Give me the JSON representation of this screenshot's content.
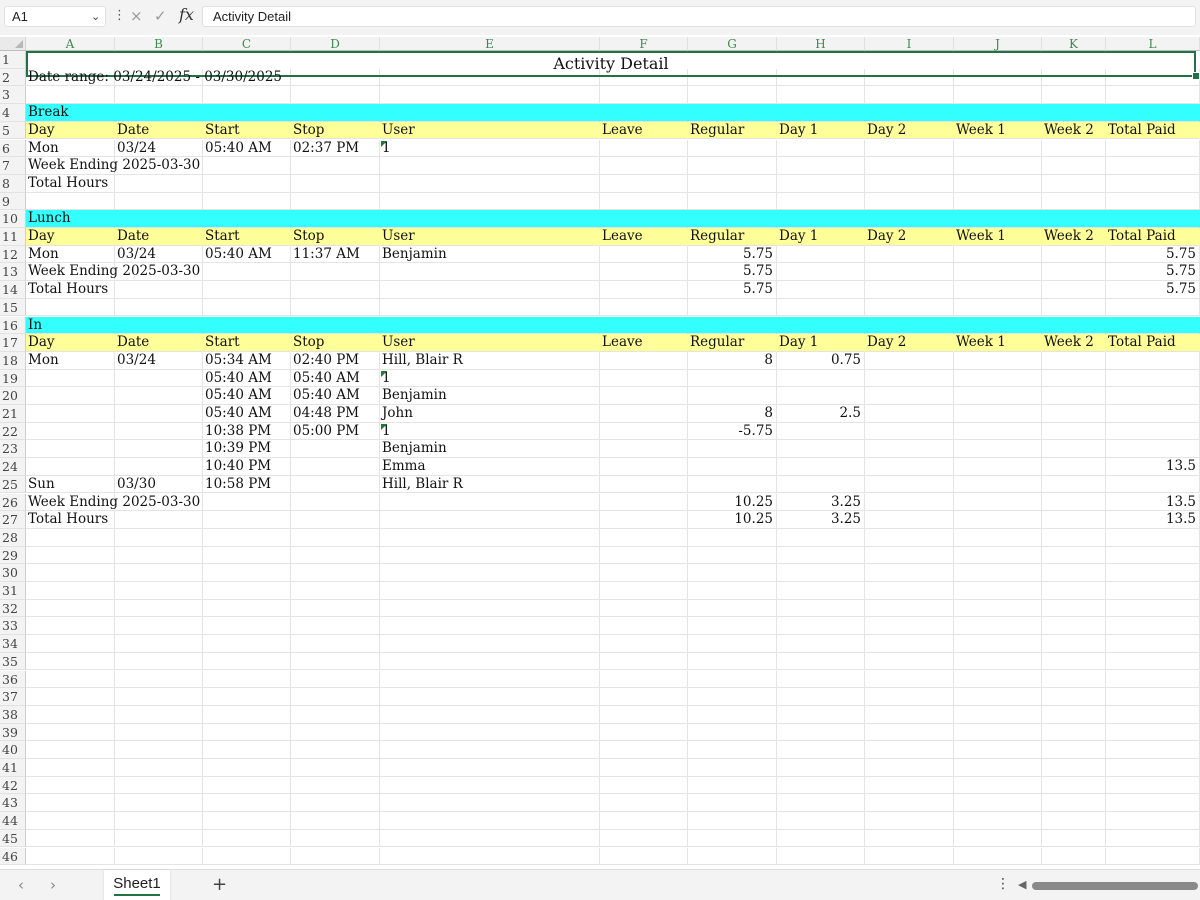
{
  "formula_bar": {
    "name_box": "A1",
    "formula": "Activity Detail",
    "x_icon": "×",
    "check_icon": "✓",
    "fx_label": "fx"
  },
  "columns": [
    "A",
    "B",
    "C",
    "D",
    "E",
    "F",
    "G",
    "H",
    "I",
    "J",
    "K",
    "L"
  ],
  "row_numbers": [
    "1",
    "2",
    "3",
    "4",
    "5",
    "6",
    "7",
    "8",
    "9",
    "10",
    "11",
    "12",
    "13",
    "14",
    "15",
    "16",
    "17",
    "18",
    "19",
    "20",
    "21",
    "22",
    "23",
    "24",
    "25",
    "26",
    "27",
    "28",
    "29",
    "30",
    "31",
    "32",
    "33",
    "34",
    "35",
    "36",
    "37",
    "38",
    "39",
    "40",
    "41",
    "42",
    "43",
    "44",
    "45",
    "46"
  ],
  "sheet": {
    "title": "Activity Detail",
    "date_range": "Date range: 03/24/2025 - 03/30/2025",
    "header_labels": [
      "Day",
      "Date",
      "Start",
      "Stop",
      "User",
      "Leave",
      "Regular",
      "Day 1",
      "Day 2",
      "Week 1",
      "Week 2",
      "Total Paid"
    ],
    "sections": [
      {
        "name": "Break",
        "rows": [
          {
            "day": "Mon",
            "date": "03/24",
            "start": "05:40 AM",
            "stop": "02:37 PM",
            "user": "1",
            "regular": "",
            "day1": "",
            "total": ""
          }
        ],
        "week_ending": {
          "label": "Week Ending 2025-03-30",
          "regular": "",
          "day1": "",
          "total": ""
        },
        "total_hours": {
          "label": "Total Hours",
          "regular": "",
          "day1": "",
          "total": ""
        }
      },
      {
        "name": "Lunch",
        "rows": [
          {
            "day": "Mon",
            "date": "03/24",
            "start": "05:40 AM",
            "stop": "11:37 AM",
            "user": "Benjamin",
            "regular": "5.75",
            "day1": "",
            "total": "5.75"
          }
        ],
        "week_ending": {
          "label": "Week Ending 2025-03-30",
          "regular": "5.75",
          "day1": "",
          "total": "5.75"
        },
        "total_hours": {
          "label": "Total Hours",
          "regular": "5.75",
          "day1": "",
          "total": "5.75"
        }
      },
      {
        "name": "In",
        "rows": [
          {
            "day": "Mon",
            "date": "03/24",
            "start": "05:34 AM",
            "stop": "02:40 PM",
            "user": "Hill, Blair R",
            "regular": "8",
            "day1": "0.75",
            "total": ""
          },
          {
            "day": "",
            "date": "",
            "start": "05:40 AM",
            "stop": "05:40 AM",
            "user": "1",
            "regular": "",
            "day1": "",
            "total": ""
          },
          {
            "day": "",
            "date": "",
            "start": "05:40 AM",
            "stop": "05:40 AM",
            "user": "Benjamin",
            "regular": "",
            "day1": "",
            "total": ""
          },
          {
            "day": "",
            "date": "",
            "start": "05:40 AM",
            "stop": "04:48 PM",
            "user": "John",
            "regular": "8",
            "day1": "2.5",
            "total": ""
          },
          {
            "day": "",
            "date": "",
            "start": "10:38 PM",
            "stop": "05:00 PM",
            "user": "1",
            "regular": "-5.75",
            "day1": "",
            "total": ""
          },
          {
            "day": "",
            "date": "",
            "start": "10:39 PM",
            "stop": "",
            "user": "Benjamin",
            "regular": "",
            "day1": "",
            "total": ""
          },
          {
            "day": "",
            "date": "",
            "start": "10:40 PM",
            "stop": "",
            "user": "Emma",
            "regular": "",
            "day1": "",
            "total": "13.5"
          },
          {
            "day": "Sun",
            "date": "03/30",
            "start": "10:58 PM",
            "stop": "",
            "user": "Hill, Blair R",
            "regular": "",
            "day1": "",
            "total": ""
          }
        ],
        "week_ending": {
          "label": "Week Ending 2025-03-30",
          "regular": "10.25",
          "day1": "3.25",
          "total": "13.5"
        },
        "total_hours": {
          "label": "Total Hours",
          "regular": "10.25",
          "day1": "3.25",
          "total": "13.5"
        }
      }
    ]
  },
  "tabs": {
    "sheets": [
      "Sheet1"
    ],
    "active": "Sheet1",
    "add_label": "+",
    "prev_label": "‹",
    "next_label": "›",
    "more_label": "⋮"
  },
  "colors": {
    "section_fill": "#33ffff",
    "header_fill": "#ffff99",
    "selection": "#217346"
  }
}
